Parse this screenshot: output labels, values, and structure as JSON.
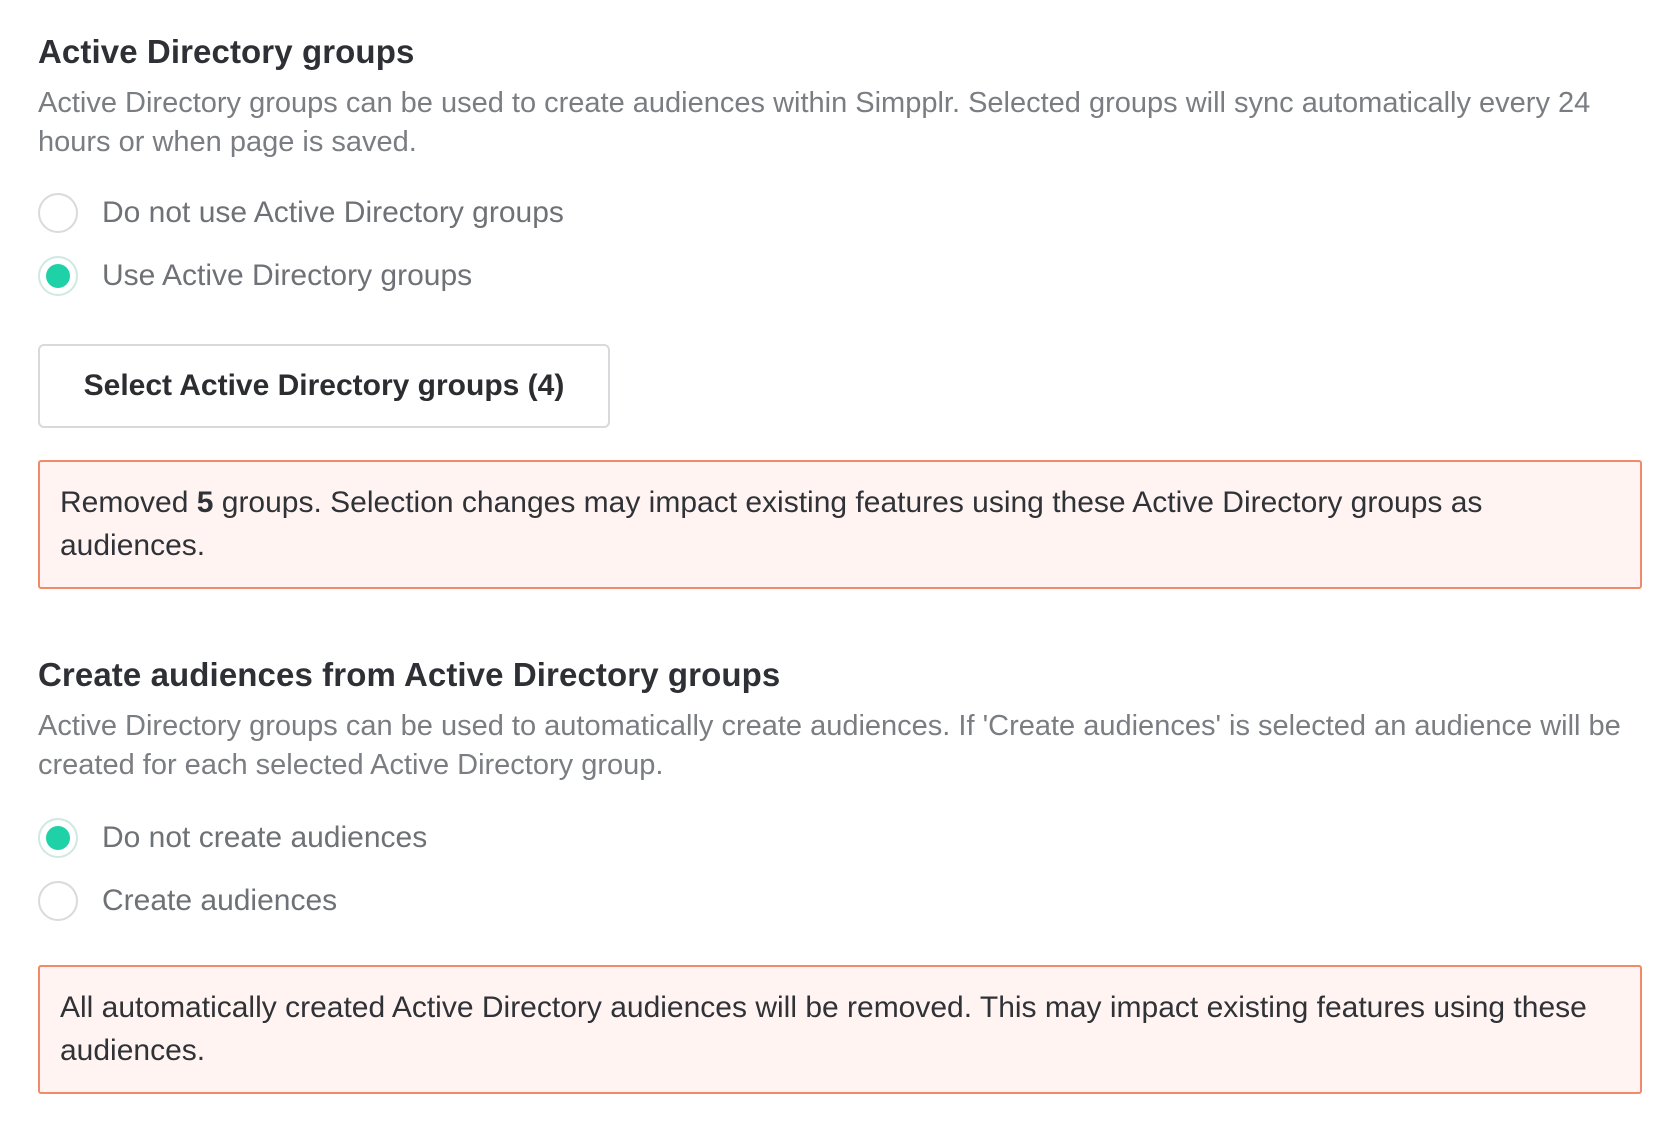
{
  "ad_groups": {
    "title": "Active Directory groups",
    "description": "Active Directory groups can be used to create audiences within Simpplr. Selected groups will sync automatically every 24 hours or when page is saved.",
    "options": [
      {
        "label": "Do not use Active Directory groups",
        "selected": false
      },
      {
        "label": "Use Active Directory groups",
        "selected": true
      }
    ],
    "select_button_label": "Select Active Directory groups (4)",
    "alert": {
      "prefix": "Removed ",
      "count": "5",
      "suffix": " groups. Selection changes may impact existing features using these Active Directory groups as audiences."
    }
  },
  "audiences": {
    "title": "Create audiences from Active Directory groups",
    "description": "Active Directory groups can be used to automatically create audiences. If 'Create audiences' is selected an audience will be created for each selected Active Directory group.",
    "options": [
      {
        "label": "Do not create audiences",
        "selected": true
      },
      {
        "label": "Create audiences",
        "selected": false
      }
    ],
    "alert": "All automatically created Active Directory audiences will be removed. This may impact existing features using these audiences."
  },
  "colors": {
    "radio_selected": "#1fd1a7",
    "alert_border": "#f08a6b",
    "alert_background": "#fff4f1"
  }
}
